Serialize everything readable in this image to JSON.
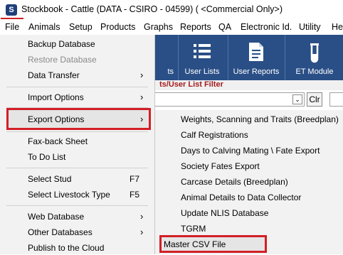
{
  "window": {
    "app_icon_letter": "S",
    "title": "Stockbook - Cattle (DATA - CSIRO - 04599) ( <Commercial Only>)"
  },
  "menubar": [
    "File",
    "Animals",
    "Setup",
    "Products",
    "Graphs",
    "Reports",
    "QA",
    "Electronic Id.",
    "Utility",
    "Help"
  ],
  "toolbar": {
    "partial_label": "ts",
    "user_lists": "User Lists",
    "user_reports": "User Reports",
    "et_module": "ET Module"
  },
  "filter": {
    "label": "ts/User List Filter",
    "clear_button": "Clr"
  },
  "file_menu": {
    "backup": "Backup Database",
    "restore": "Restore Database",
    "data_transfer": "Data Transfer",
    "import_options": "Import Options",
    "export_options": "Export Options",
    "fax_back": "Fax-back Sheet",
    "todo": "To Do List",
    "select_stud": "Select Stud",
    "select_stud_key": "F7",
    "select_livestock": "Select Livestock Type",
    "select_livestock_key": "F5",
    "web_database": "Web Database",
    "other_databases": "Other Databases",
    "publish_cloud": "Publish to the Cloud"
  },
  "export_submenu": [
    "Weights, Scanning and Traits (Breedplan)",
    "Calf Registrations",
    "Days to Calving Mating \\ Fate Export",
    "Society Fates Export",
    "Carcase Details (Breedplan)",
    "Animal Details to Data Collector",
    "Update NLIS Database",
    "TGRM",
    "Master CSV File"
  ],
  "colors": {
    "highlight_border": "#d21f26",
    "toolbar_bg": "#2a4f86",
    "filter_text": "#a21c1c"
  }
}
